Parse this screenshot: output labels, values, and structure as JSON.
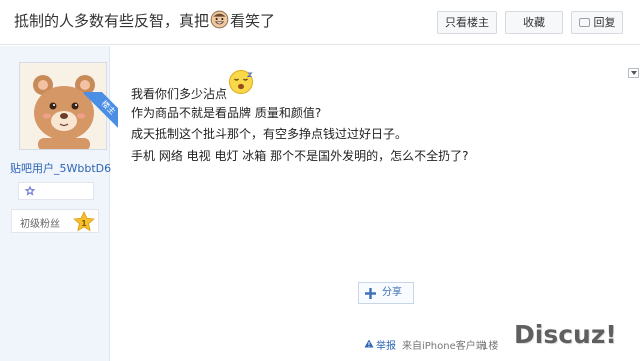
{
  "thread": {
    "title_before": "抵制的人多数有些反智，真把",
    "title_after": "看笑了",
    "title_emoji_icon": "grinning-face-emoji-icon"
  },
  "toolbar": {
    "only_op_label": "只看楼主",
    "collect_label": "收藏",
    "reply_label": "回复"
  },
  "author": {
    "username": "贴吧用户_5WbbtD6",
    "op_badge": "楼主",
    "avatar_icon": "bear-avatar-icon",
    "level_label": "初级粉丝",
    "level_number": "1"
  },
  "post": {
    "lines": [
      "我看你们多少沾点",
      "作为商品不就是看品牌 质量和颜值?",
      "成天抵制这个批斗那个，有空多挣点钱过过好日子。",
      "手机 网络 电视 电灯 冰箱 那个不是国外发明的，怎么不全扔了?"
    ],
    "inline_emoji_icon": "sleepy-face-emoji-icon"
  },
  "actions": {
    "share_label": "分享",
    "report_label": "举报",
    "client_text": "来自iPhone客户端",
    "floor_text": "1楼"
  },
  "watermark": {
    "text": "Discuz!"
  },
  "colors": {
    "link": "#2d64b3",
    "sidebar_bg": "#f0f5fb",
    "op_badge_bg": "#4b8ee6"
  }
}
